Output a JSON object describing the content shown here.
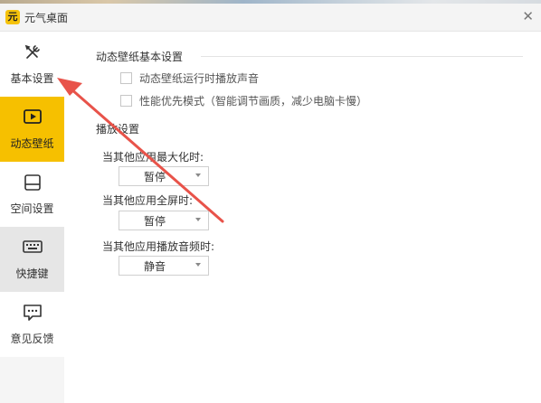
{
  "window": {
    "app_name": "元气桌面",
    "logo_text": "元"
  },
  "sidebar": {
    "items": [
      {
        "label": "基本设置",
        "icon": "wrench-screwdriver-icon"
      },
      {
        "label": "动态壁纸",
        "icon": "play-video-icon"
      },
      {
        "label": "空间设置",
        "icon": "drive-icon"
      },
      {
        "label": "快捷键",
        "icon": "keyboard-icon"
      },
      {
        "label": "意见反馈",
        "icon": "feedback-chat-icon"
      }
    ],
    "active_index": 1
  },
  "main": {
    "basic_section": {
      "title": "动态壁纸基本设置",
      "options": [
        {
          "label": "动态壁纸运行时播放声音",
          "checked": false
        },
        {
          "label": "性能优先模式（智能调节画质，减少电脑卡慢）",
          "checked": false
        }
      ]
    },
    "play_section": {
      "title": "播放设置",
      "rows": [
        {
          "label": "当其他应用最大化时:",
          "value": "暂停"
        },
        {
          "label": "当其他应用全屏时:",
          "value": "暂停"
        },
        {
          "label": "当其他应用播放音频时:",
          "value": "静音"
        }
      ]
    }
  },
  "colors": {
    "accent": "#f6c000",
    "annotation_arrow": "#e8534a"
  }
}
